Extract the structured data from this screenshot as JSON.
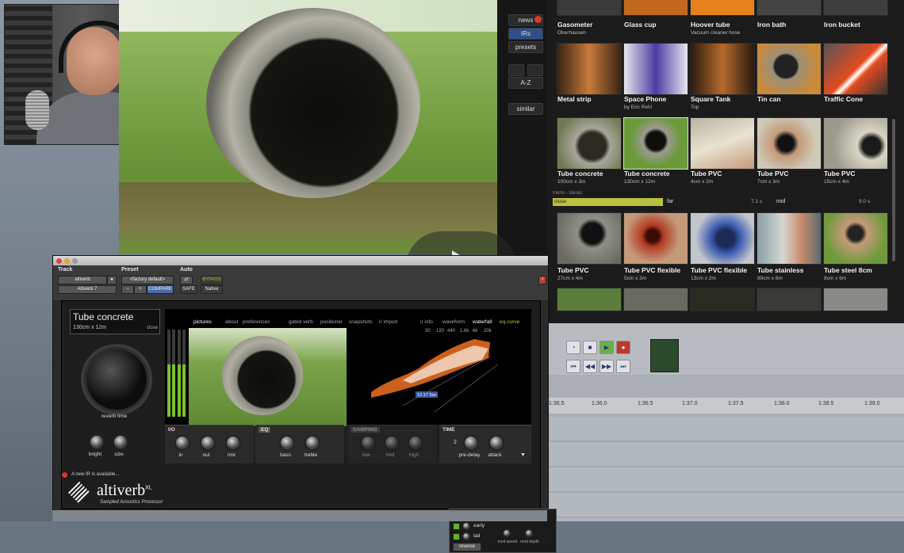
{
  "browser": {
    "sidebar": {
      "news": "news",
      "irs": "IRs",
      "presets": "presets",
      "sort": "A-Z",
      "similar": "similar"
    },
    "row1": [
      {
        "name": "Gasometer",
        "size": "Oberhausen"
      },
      {
        "name": "Glass cup",
        "size": ""
      },
      {
        "name": "Hoover tube",
        "size": "Vacuum cleaner hose"
      },
      {
        "name": "Iron bath",
        "size": ""
      },
      {
        "name": "Iron bucket",
        "size": ""
      }
    ],
    "row2": [
      {
        "name": "Metal strip",
        "size": ""
      },
      {
        "name": "Space Phone",
        "size": "by Eric Rehl"
      },
      {
        "name": "Square Tank",
        "size": "Top"
      },
      {
        "name": "Tin can",
        "size": ""
      },
      {
        "name": "Traffic Cone",
        "size": ""
      }
    ],
    "row3": [
      {
        "name": "Tube concrete",
        "size": "100cm x 3m"
      },
      {
        "name": "Tube concrete",
        "size": "130cm x 12m"
      },
      {
        "name": "Tube PVC",
        "size": "4cm x 2m"
      },
      {
        "name": "Tube PVC",
        "size": "7cm x 3m"
      },
      {
        "name": "Tube PVC",
        "size": "15cm x 4m"
      }
    ],
    "filter": {
      "header": "mono - stereo",
      "close": "close",
      "close_val": "10.2 s",
      "far": "far",
      "far_val": "7.1 s",
      "mid": "mid",
      "mid_val": "9.0 s"
    },
    "row4": [
      {
        "name": "Tube PVC",
        "size": "27cm x 4m"
      },
      {
        "name": "Tube PVC flexible",
        "size": "5cm x 3m"
      },
      {
        "name": "Tube PVC flexible",
        "size": "13cm x 2m"
      },
      {
        "name": "Tube stainless",
        "size": "80cm x 6m"
      },
      {
        "name": "Tube steel 8cm",
        "size": "8cm x 6m"
      }
    ]
  },
  "daw": {
    "timeline": [
      "1:36.5",
      "1:36.0",
      "1:36.5",
      "1:37.0",
      "1:37.5",
      "1:38.0",
      "1:38.5",
      "1:39.0"
    ]
  },
  "plugin": {
    "track_label": "Track",
    "track_name": "altiverb",
    "track_sub": "Altiverb 7",
    "preset_label": "Preset",
    "preset_value": "<factory default>",
    "compare": "COMPARE",
    "auto_label": "Auto",
    "bypass": "BYPASS",
    "safe": "SAFE",
    "native": "Native",
    "ir_name": "Tube concrete",
    "ir_size": "130cm x 12m",
    "ir_pos": "close",
    "reverb_time": "reverb time",
    "tabs": [
      "pictures",
      "about",
      "preferences",
      "gated verb",
      "positioner",
      "snapshots",
      "ir import",
      "ir info",
      "waveform",
      "waterfall",
      "eq-curve"
    ],
    "freqs": [
      "30",
      "120",
      "440",
      "1.6k",
      "6k",
      "20k"
    ],
    "time_readout": "12.17 Sec",
    "knobs": {
      "bright": "bright",
      "size": "size",
      "in": "in",
      "out": "out",
      "mix": "mix",
      "bass": "bass",
      "treble": "treble",
      "low": "low",
      "mid": "mid",
      "high": "high",
      "predelay": "pre-delay",
      "attack": "attack"
    },
    "sections": {
      "io": "I/O",
      "eq": "EQ",
      "damping": "DAMPING",
      "time": "TIME"
    },
    "predelay_val": "2",
    "notice": "A new IR is available...",
    "logo": "altiverb",
    "logo_xl": "XL",
    "logo_sub": "Sampled Acoustics Processor",
    "mix": {
      "direct": "direct",
      "color": "color",
      "early": "early",
      "tail": "tail",
      "flat": "flat",
      "mod_speed": "mod speed",
      "mod_depth": "mod depth",
      "reverse": "reverse"
    }
  }
}
